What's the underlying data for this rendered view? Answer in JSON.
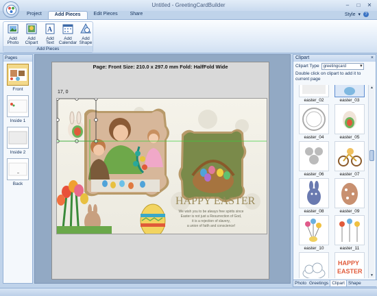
{
  "window": {
    "title": "Untitled - GreetingCardBuilder"
  },
  "ribbon_tabs": [
    "Project",
    "Add Pieces",
    "Edit Pieces",
    "Share"
  ],
  "style_menu": "Style",
  "help_glyph": "?",
  "ribbon": {
    "group_label": "Add Pieces",
    "buttons": [
      {
        "line1": "Add",
        "line2": "Photo",
        "icon": "photo-icon"
      },
      {
        "line1": "Add",
        "line2": "Clipart",
        "icon": "clipart-icon"
      },
      {
        "line1": "Add",
        "line2": "Text",
        "icon": "text-icon"
      },
      {
        "line1": "Add",
        "line2": "Calendar",
        "icon": "calendar-icon"
      },
      {
        "line1": "Add",
        "line2": "Shape",
        "icon": "shape-icon"
      }
    ]
  },
  "pages_panel": {
    "title": "Pages",
    "pages": [
      "Front",
      "Inside 1",
      "Inside 2",
      "Back"
    ]
  },
  "canvas": {
    "page_info": "Page: Front  Size: 210.0 x 297.0 mm   Fold: HalfFold Wide",
    "coordinate": "17, 0",
    "card": {
      "headline": "HAPPY EASTER",
      "verse": [
        "We wish you to be always free spirits since",
        "Easter is not just a Resurrection of God,",
        "it is a rejection of slavery,",
        "a union of faith and conscience!"
      ]
    }
  },
  "clipart_panel": {
    "title": "Clipart",
    "close": "×",
    "type_label": "Clipart Type",
    "type_value": "greetingcard",
    "help": "Double click on clipart to add it to current page",
    "items": [
      "easter_02",
      "easter_03",
      "easter_04",
      "easter_05",
      "easter_06",
      "easter_07",
      "easter_08",
      "easter_09",
      "easter_10",
      "easter_11"
    ],
    "bottom_tabs": [
      "Photo",
      "Greetings",
      "Clipart",
      "Shape"
    ],
    "active_tab": "Clipart"
  },
  "colors": {
    "accent": "#3a73c4",
    "ribbon_bg": "#dfeaf7",
    "canvas_bg": "#92a9c4"
  }
}
